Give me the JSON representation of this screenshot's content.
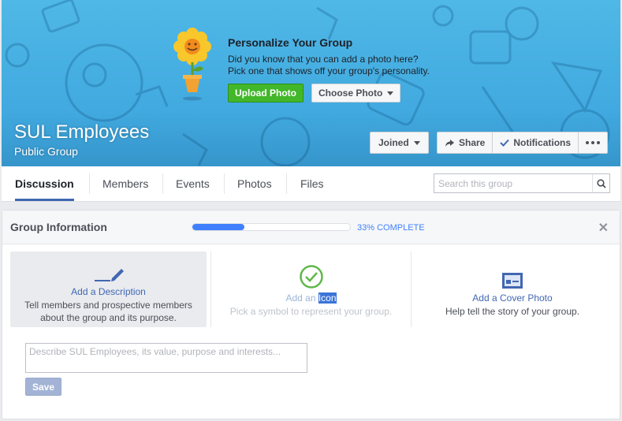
{
  "promo": {
    "title": "Personalize Your Group",
    "line1": "Did you know that you can add a photo here?",
    "line2": "Pick one that shows off your group's personality.",
    "upload_label": "Upload Photo",
    "choose_label": "Choose Photo"
  },
  "group": {
    "name": "SUL Employees",
    "type": "Public Group"
  },
  "actions": {
    "joined": "Joined",
    "share": "Share",
    "notifications": "Notifications"
  },
  "tabs": [
    "Discussion",
    "Members",
    "Events",
    "Photos",
    "Files"
  ],
  "search": {
    "placeholder": "Search this group"
  },
  "info": {
    "title": "Group Information",
    "progress_label": "33% COMPLETE",
    "progress_fraction": 0.33,
    "options": [
      {
        "title": "Add a Description",
        "desc1": "Tell members and prospective members",
        "desc2": "about the group and its purpose."
      },
      {
        "title_pre": "Add an ",
        "title_hl": "Icon",
        "desc1": "Pick a symbol to represent your group."
      },
      {
        "title": "Add a Cover Photo",
        "desc1": "Help tell the story of your group."
      }
    ],
    "textarea_placeholder": "Describe SUL Employees, its value, purpose and interests...",
    "save_label": "Save"
  },
  "colors": {
    "cover": "#3aa2dc",
    "accent": "#4080ff",
    "green": "#42b72a",
    "link": "#4267b2"
  }
}
